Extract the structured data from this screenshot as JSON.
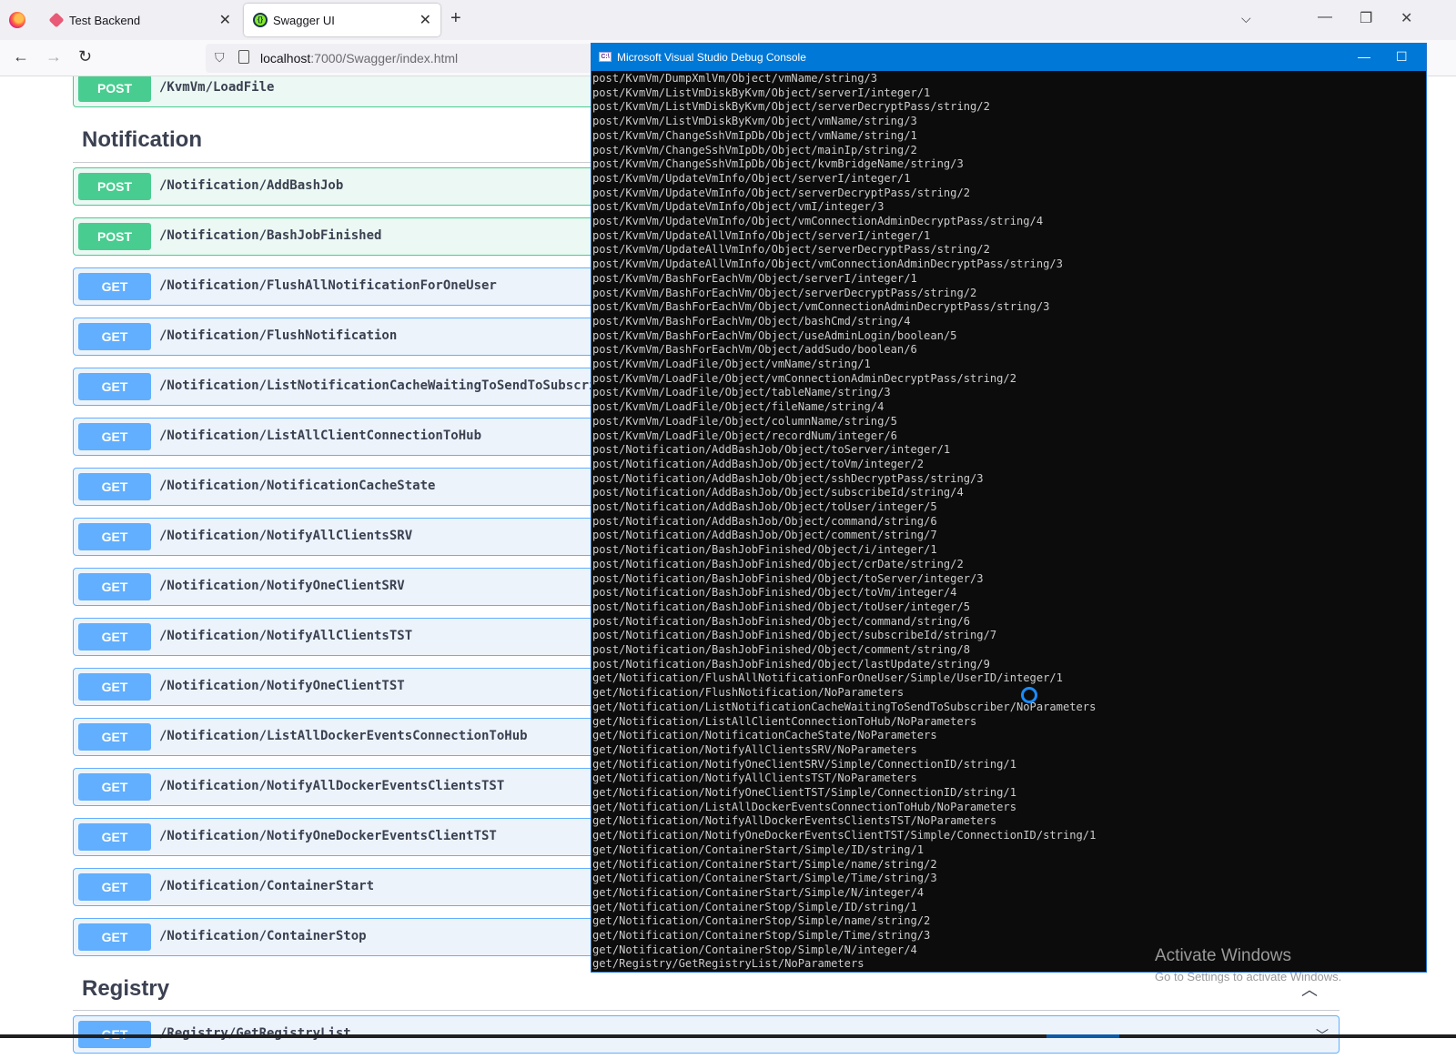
{
  "browser": {
    "tabs": [
      {
        "title": "Test Backend",
        "active": false
      },
      {
        "title": "Swagger UI",
        "active": true
      }
    ],
    "url_host": "localhost",
    "url_rest": ":7000/Swagger/index.html"
  },
  "swagger": {
    "top_op": {
      "method": "POST",
      "path": "/KvmVm/LoadFile"
    },
    "notification_title": "Notification",
    "notification_ops": [
      {
        "method": "POST",
        "path": "/Notification/AddBashJob"
      },
      {
        "method": "POST",
        "path": "/Notification/BashJobFinished"
      },
      {
        "method": "GET",
        "path": "/Notification/FlushAllNotificationForOneUser"
      },
      {
        "method": "GET",
        "path": "/Notification/FlushNotification"
      },
      {
        "method": "GET",
        "path": "/Notification/ListNotificationCacheWaitingToSendToSubscriber"
      },
      {
        "method": "GET",
        "path": "/Notification/ListAllClientConnectionToHub"
      },
      {
        "method": "GET",
        "path": "/Notification/NotificationCacheState"
      },
      {
        "method": "GET",
        "path": "/Notification/NotifyAllClientsSRV"
      },
      {
        "method": "GET",
        "path": "/Notification/NotifyOneClientSRV"
      },
      {
        "method": "GET",
        "path": "/Notification/NotifyAllClientsTST"
      },
      {
        "method": "GET",
        "path": "/Notification/NotifyOneClientTST"
      },
      {
        "method": "GET",
        "path": "/Notification/ListAllDockerEventsConnectionToHub"
      },
      {
        "method": "GET",
        "path": "/Notification/NotifyAllDockerEventsClientsTST"
      },
      {
        "method": "GET",
        "path": "/Notification/NotifyOneDockerEventsClientTST"
      },
      {
        "method": "GET",
        "path": "/Notification/ContainerStart"
      },
      {
        "method": "GET",
        "path": "/Notification/ContainerStop"
      }
    ],
    "registry_title": "Registry",
    "registry_op": {
      "method": "GET",
      "path": "/Registry/GetRegistryList"
    }
  },
  "console": {
    "title": "Microsoft Visual Studio Debug Console",
    "lines": [
      "post/KvmVm/DumpXmlVm/Object/vmName/string/3",
      "post/KvmVm/ListVmDiskByKvm/Object/serverI/integer/1",
      "post/KvmVm/ListVmDiskByKvm/Object/serverDecryptPass/string/2",
      "post/KvmVm/ListVmDiskByKvm/Object/vmName/string/3",
      "post/KvmVm/ChangeSshVmIpDb/Object/vmName/string/1",
      "post/KvmVm/ChangeSshVmIpDb/Object/mainIp/string/2",
      "post/KvmVm/ChangeSshVmIpDb/Object/kvmBridgeName/string/3",
      "post/KvmVm/UpdateVmInfo/Object/serverI/integer/1",
      "post/KvmVm/UpdateVmInfo/Object/serverDecryptPass/string/2",
      "post/KvmVm/UpdateVmInfo/Object/vmI/integer/3",
      "post/KvmVm/UpdateVmInfo/Object/vmConnectionAdminDecryptPass/string/4",
      "post/KvmVm/UpdateAllVmInfo/Object/serverI/integer/1",
      "post/KvmVm/UpdateAllVmInfo/Object/serverDecryptPass/string/2",
      "post/KvmVm/UpdateAllVmInfo/Object/vmConnectionAdminDecryptPass/string/3",
      "post/KvmVm/BashForEachVm/Object/serverI/integer/1",
      "post/KvmVm/BashForEachVm/Object/serverDecryptPass/string/2",
      "post/KvmVm/BashForEachVm/Object/vmConnectionAdminDecryptPass/string/3",
      "post/KvmVm/BashForEachVm/Object/bashCmd/string/4",
      "post/KvmVm/BashForEachVm/Object/useAdminLogin/boolean/5",
      "post/KvmVm/BashForEachVm/Object/addSudo/boolean/6",
      "post/KvmVm/LoadFile/Object/vmName/string/1",
      "post/KvmVm/LoadFile/Object/vmConnectionAdminDecryptPass/string/2",
      "post/KvmVm/LoadFile/Object/tableName/string/3",
      "post/KvmVm/LoadFile/Object/fileName/string/4",
      "post/KvmVm/LoadFile/Object/columnName/string/5",
      "post/KvmVm/LoadFile/Object/recordNum/integer/6",
      "post/Notification/AddBashJob/Object/toServer/integer/1",
      "post/Notification/AddBashJob/Object/toVm/integer/2",
      "post/Notification/AddBashJob/Object/sshDecryptPass/string/3",
      "post/Notification/AddBashJob/Object/subscribeId/string/4",
      "post/Notification/AddBashJob/Object/toUser/integer/5",
      "post/Notification/AddBashJob/Object/command/string/6",
      "post/Notification/AddBashJob/Object/comment/string/7",
      "post/Notification/BashJobFinished/Object/i/integer/1",
      "post/Notification/BashJobFinished/Object/crDate/string/2",
      "post/Notification/BashJobFinished/Object/toServer/integer/3",
      "post/Notification/BashJobFinished/Object/toVm/integer/4",
      "post/Notification/BashJobFinished/Object/toUser/integer/5",
      "post/Notification/BashJobFinished/Object/command/string/6",
      "post/Notification/BashJobFinished/Object/subscribeId/string/7",
      "post/Notification/BashJobFinished/Object/comment/string/8",
      "post/Notification/BashJobFinished/Object/lastUpdate/string/9",
      "get/Notification/FlushAllNotificationForOneUser/Simple/UserID/integer/1",
      "get/Notification/FlushNotification/NoParameters",
      "get/Notification/ListNotificationCacheWaitingToSendToSubscriber/NoParameters",
      "get/Notification/ListAllClientConnectionToHub/NoParameters",
      "get/Notification/NotificationCacheState/NoParameters",
      "get/Notification/NotifyAllClientsSRV/NoParameters",
      "get/Notification/NotifyOneClientSRV/Simple/ConnectionID/string/1",
      "get/Notification/NotifyAllClientsTST/NoParameters",
      "get/Notification/NotifyOneClientTST/Simple/ConnectionID/string/1",
      "get/Notification/ListAllDockerEventsConnectionToHub/NoParameters",
      "get/Notification/NotifyAllDockerEventsClientsTST/NoParameters",
      "get/Notification/NotifyOneDockerEventsClientTST/Simple/ConnectionID/string/1",
      "get/Notification/ContainerStart/Simple/ID/string/1",
      "get/Notification/ContainerStart/Simple/name/string/2",
      "get/Notification/ContainerStart/Simple/Time/string/3",
      "get/Notification/ContainerStart/Simple/N/integer/4",
      "get/Notification/ContainerStop/Simple/ID/string/1",
      "get/Notification/ContainerStop/Simple/name/string/2",
      "get/Notification/ContainerStop/Simple/Time/string/3",
      "get/Notification/ContainerStop/Simple/N/integer/4",
      "get/Registry/GetRegistryList/NoParameters"
    ]
  },
  "watermark": {
    "title": "Activate Windows",
    "subtitle": "Go to Settings to activate Windows."
  },
  "colors": {
    "post": "#49cc90",
    "get": "#61affe",
    "console_bg": "#0c0c0c",
    "console_title": "#0078d7"
  }
}
